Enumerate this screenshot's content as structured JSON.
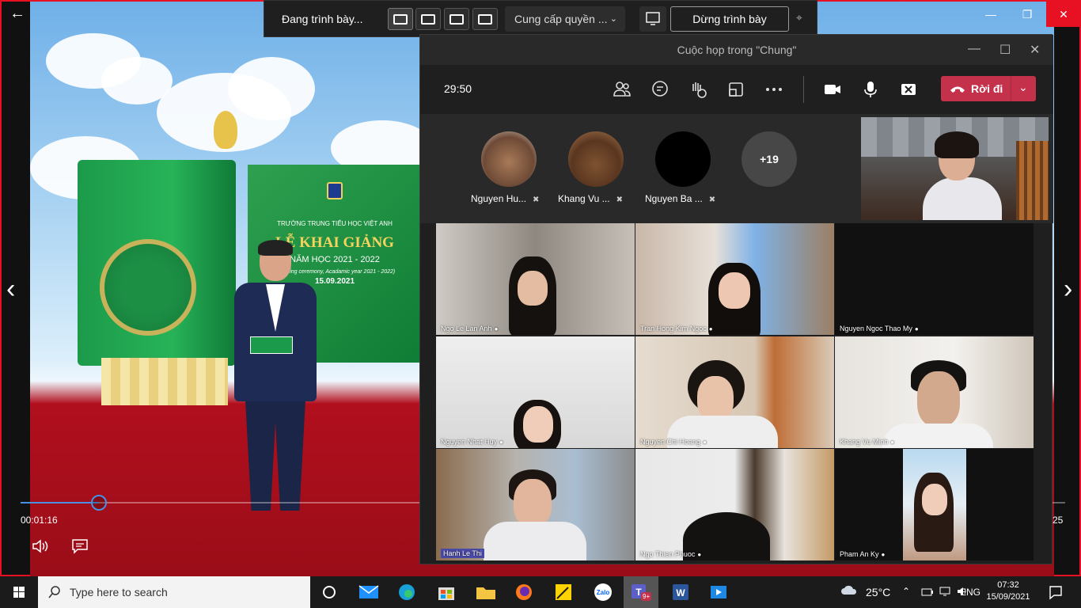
{
  "player": {
    "time_current": "00:01:16",
    "time_end": "25",
    "progress": 0.075,
    "board": {
      "school": "TRƯỜNG TRUNG TIỂU HỌC VIỆT ANH",
      "event": "LỄ KHAI GIẢNG",
      "year": "NĂM HỌC 2021 - 2022",
      "subtitle": "(Opening ceremony, Acadamic year 2021 - 2022)",
      "date": "15.09.2021"
    }
  },
  "presenter_toolbar": {
    "status": "Đang trình bày...",
    "control_label": "Cung cấp quyền ...",
    "stop_label": "Dừng trình bày"
  },
  "meeting": {
    "title": "Cuộc họp trong \"Chung\"",
    "timer": "29:50",
    "leave_label": "Rời đi",
    "roster": [
      {
        "name": "Nguyen Hu..."
      },
      {
        "name": "Khang Vu ..."
      },
      {
        "name": "Nguyen Ba ..."
      }
    ],
    "overflow_count": "+19",
    "tiles": [
      {
        "name": "Ngo Le Lan Anh"
      },
      {
        "name": "Tran Hong Kim Ngoc"
      },
      {
        "name": "Nguyen Ngoc Thao My"
      },
      {
        "name": "Nguyen Nhat Huy"
      },
      {
        "name": "Nguyen Chi Hoang"
      },
      {
        "name": "Khang Vu Minh"
      },
      {
        "name": "Hanh Le Thi"
      },
      {
        "name": "Ngo Thien Phuoc"
      },
      {
        "name": "Pham An Ky"
      }
    ]
  },
  "taskbar": {
    "search_placeholder": "Type here to search",
    "teams_badge": "9+",
    "weather": "25°C",
    "language": "ENG",
    "time": "07:32",
    "date": "15/09/2021"
  }
}
